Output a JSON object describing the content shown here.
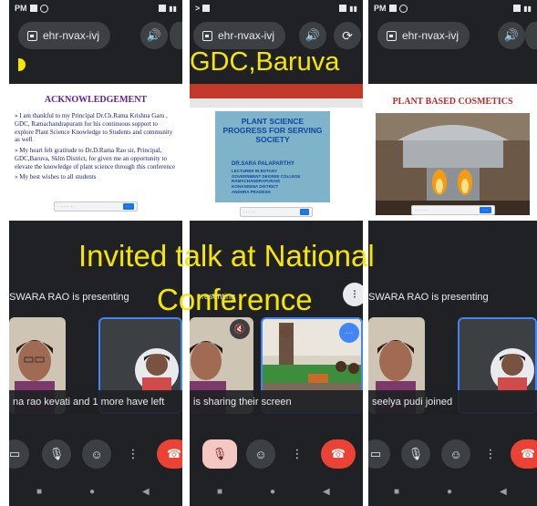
{
  "overlays": {
    "college": "GDC,Baruva",
    "talk_line1": "Invited talk at National",
    "talk_line2": "Conference"
  },
  "meeting_code": "ehr-nvax-ivj",
  "status_left": [
    "PM",
    "1",
    ">"
  ],
  "panels": [
    {
      "slide_title": "ACKNOWLEDGEMENT",
      "slide_items": [
        "I am thankful to my Principal Dr.Ch.Rama Krishna Garu , GDC, Ramachandrapuram for his continuous support to explore Plant Science Knowledge to Students and community as well",
        "My heart felt gratitude to Dr.D.Rama Rao sir, Principal, GDC,Baruva, Sklm District, for given me an opportunity to elevate the knowledge of plant science through this conference",
        "My best wishes to all students"
      ],
      "presenting_text": "SWARA RAO is presenting",
      "notice": "na rao kevati and 1 more have left"
    },
    {
      "slide_title": "PLANT SCIENCE  PROGRESS FOR SERVING SOCIETY",
      "speaker_name": "DR.SARA PALAPARTHY",
      "speaker_details": [
        "LECTURER IN BOTANY",
        "GOVERNMENT DEGREE COLLEGE",
        "RAMACHANDRAPURAM",
        "KONASEEMA DISTRICT",
        "ANDHRA PRADESH"
      ],
      "presenting_text": "presenting",
      "notice": "is sharing their screen"
    },
    {
      "slide_title": "PLANT BASED COSMETICS",
      "presenting_text": "SWARA RAO is presenting",
      "notice": "seelya pudi joined"
    }
  ],
  "colors": {
    "overlay_text": "#f7e600",
    "meet_bg": "#202124",
    "control_bg": "#3c4043",
    "end_call": "#ea4335",
    "active_tile": "#4285f4"
  }
}
